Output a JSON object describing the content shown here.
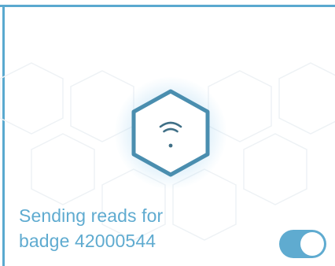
{
  "accent_color": "#5fabd0",
  "badge_status": {
    "line1": "Sending reads for",
    "line2_prefix": "badge",
    "badge_number": "42000544"
  },
  "send_reads_toggle": {
    "state": "on"
  },
  "center_icon": "wifi-hexagon-icon"
}
